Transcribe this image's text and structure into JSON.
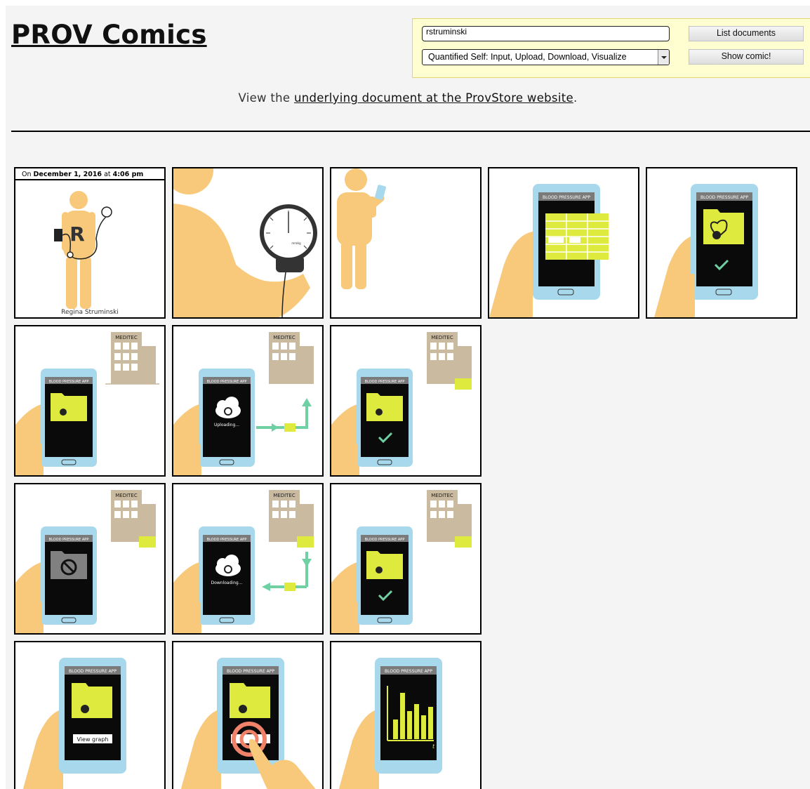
{
  "page": {
    "title": "PROV Comics"
  },
  "controls": {
    "user_value": "rstruminski",
    "selected_document": "Quantified Self: Input, Upload, Download, Visualize",
    "list_button": "List documents",
    "show_button": "Show comic!"
  },
  "view_line": {
    "prefix": "View the ",
    "link_text": "underlying document at the ProvStore website",
    "suffix": "."
  },
  "panel1": {
    "caption_prefix": "On ",
    "date": "December 1, 2016",
    "caption_mid": " at ",
    "time": "4:06 pm",
    "badge_letter": "R",
    "person_name": "Regina Struminski"
  },
  "labels": {
    "app_title": "BLOOD PRESSURE APP",
    "company": "MEDITEC",
    "gauge_unit": "mmHg",
    "uploading": "Uploading...",
    "downloading": "Downloading...",
    "view_graph": "View graph",
    "axis_t": "t"
  },
  "colors": {
    "skin": "#f8c97a",
    "phone": "#a7d8ec",
    "screen": "#0a0a0a",
    "folder": "#dfea3e",
    "arrow": "#6fd0a3",
    "building": "#c9baa0",
    "control_bg": "#fefed0"
  },
  "icons": [
    "heart-check-icon",
    "stopwatch-icon",
    "cloud-sync-icon",
    "check-icon",
    "forbidden-icon",
    "building-icon",
    "tap-ring-icon",
    "hand-icon"
  ]
}
